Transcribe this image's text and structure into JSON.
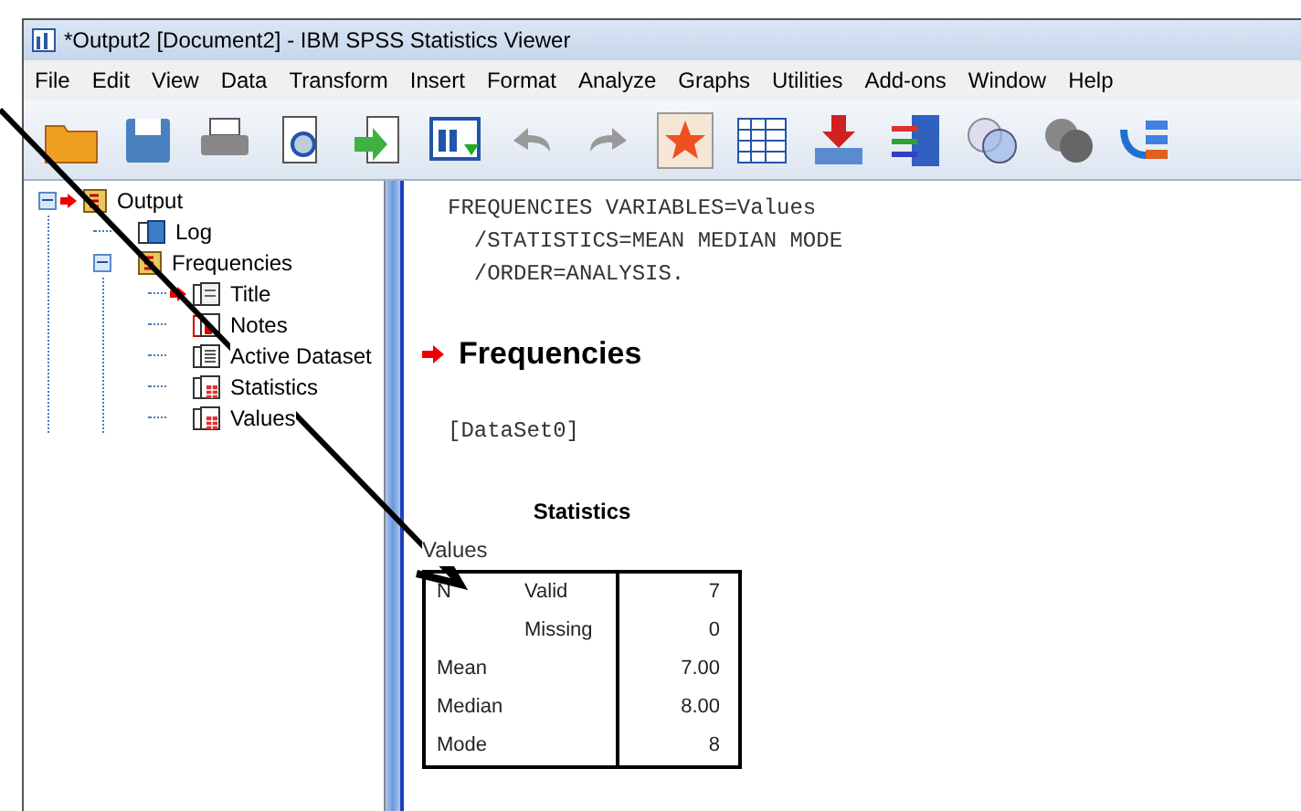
{
  "window": {
    "title": "*Output2 [Document2] - IBM SPSS Statistics Viewer"
  },
  "menu": [
    "File",
    "Edit",
    "View",
    "Data",
    "Transform",
    "Insert",
    "Format",
    "Analyze",
    "Graphs",
    "Utilities",
    "Add-ons",
    "Window",
    "Help"
  ],
  "outline": [
    {
      "label": "Output",
      "kind": "book",
      "current": true,
      "expanded": true,
      "children": [
        {
          "label": "Log",
          "kind": "log"
        },
        {
          "label": "Frequencies",
          "kind": "book",
          "current": false,
          "expanded": true,
          "children": [
            {
              "label": "Title",
              "kind": "title",
              "current": true
            },
            {
              "label": "Notes",
              "kind": "notes",
              "current": false
            },
            {
              "label": "Active Dataset",
              "kind": "text",
              "current": false
            },
            {
              "label": "Statistics",
              "kind": "table",
              "current": false
            },
            {
              "label": "Values",
              "kind": "table",
              "current": false
            }
          ]
        }
      ]
    }
  ],
  "syntax": [
    "FREQUENCIES VARIABLES=Values",
    "  /STATISTICS=MEAN MEDIAN MODE",
    "  /ORDER=ANALYSIS."
  ],
  "heading": "Frequencies",
  "dataset": "[DataSet0]",
  "table": {
    "title": "Statistics",
    "variable": "Values",
    "rows": [
      {
        "label": "N",
        "sublabel": "Valid",
        "value": "7"
      },
      {
        "label": "",
        "sublabel": "Missing",
        "value": "0"
      },
      {
        "label": "Mean",
        "sublabel": "",
        "value": "7.00"
      },
      {
        "label": "Median",
        "sublabel": "",
        "value": "8.00"
      },
      {
        "label": "Mode",
        "sublabel": "",
        "value": "8"
      }
    ]
  }
}
